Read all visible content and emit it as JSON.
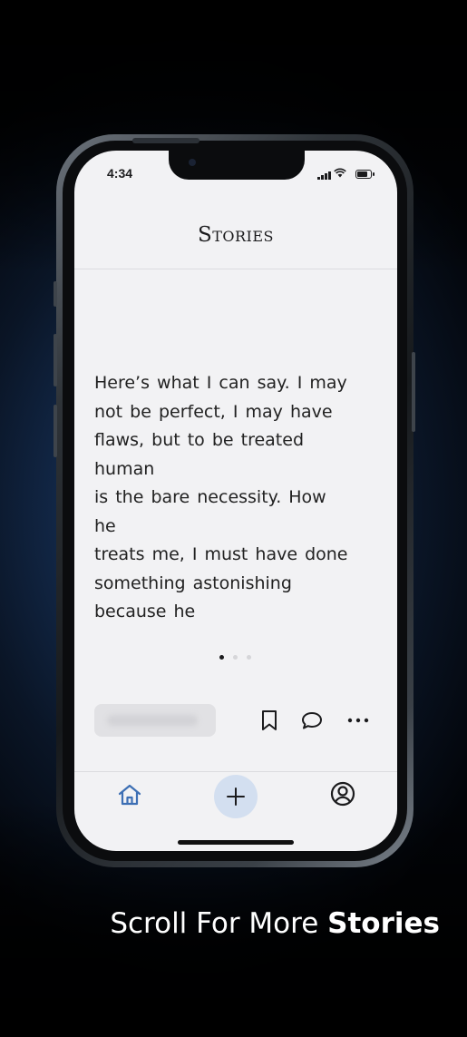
{
  "status_bar": {
    "time": "4:34"
  },
  "header": {
    "title": "Stories"
  },
  "story": {
    "lines": [
      "Here’s what I can say. I may",
      "not be perfect, I may have",
      "flaws, but to be treated",
      "human",
      "is the bare necessity. How",
      "he",
      "treats me, I must have done",
      "something astonishing",
      "because he"
    ]
  },
  "pager": {
    "pages": 3,
    "current": 1
  },
  "actions": {
    "icons": [
      "bookmark-icon",
      "comment-icon",
      "more-icon"
    ]
  },
  "tab_bar": {
    "icons": [
      "home-icon",
      "plus-icon",
      "profile-icon"
    ],
    "accent": "#3d6fb4"
  },
  "caption": {
    "light": "Scroll For More",
    "bold": "Stories"
  },
  "colors": {
    "screen_bg": "#f2f2f4",
    "text": "#1b1b1d",
    "add_button_bg": "#d3dff0"
  }
}
